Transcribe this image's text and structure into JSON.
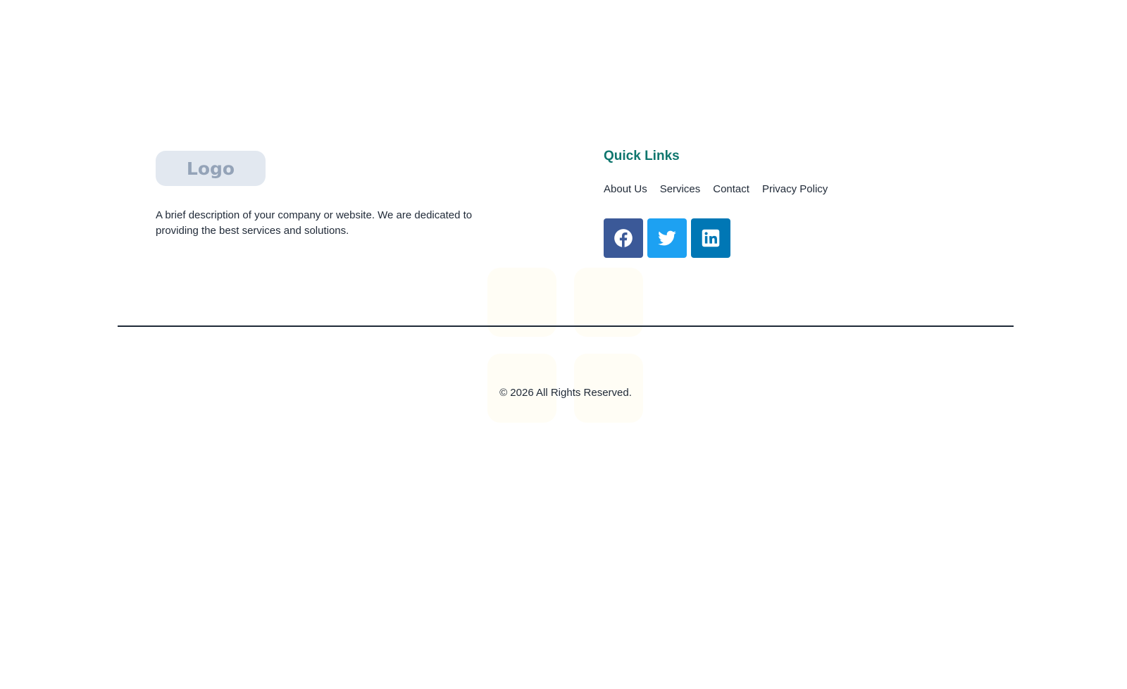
{
  "logo": {
    "text": "Logo"
  },
  "description": "A brief description of your company or website. We are dedicated to providing the best services and solutions.",
  "quick_links": {
    "title": "Quick Links",
    "items": [
      {
        "label": "About Us"
      },
      {
        "label": "Services"
      },
      {
        "label": "Contact"
      },
      {
        "label": "Privacy Policy"
      }
    ]
  },
  "social": [
    {
      "name": "facebook",
      "icon": "facebook-icon",
      "color": "#3b5998"
    },
    {
      "name": "twitter",
      "icon": "twitter-icon",
      "color": "#1da1f2"
    },
    {
      "name": "linkedin",
      "icon": "linkedin-icon",
      "color": "#0077b5"
    }
  ],
  "copyright": "© 2026 All Rights Reserved."
}
